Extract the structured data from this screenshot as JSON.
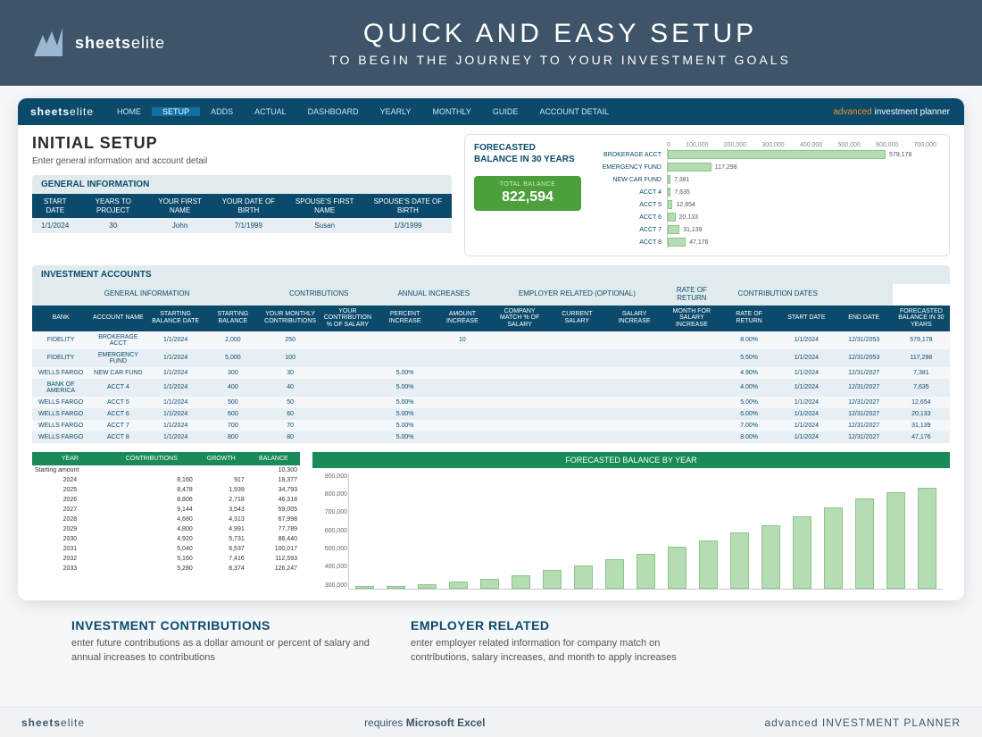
{
  "brand": {
    "name_bold": "sheets",
    "name_light": "elite"
  },
  "banner": {
    "title": "QUICK AND EASY SETUP",
    "subtitle": "TO BEGIN THE JOURNEY TO YOUR INVESTMENT GOALS"
  },
  "nav": {
    "items": [
      "HOME",
      "SETUP",
      "ADDS",
      "ACTUAL",
      "DASHBOARD",
      "YEARLY",
      "MONTHLY",
      "GUIDE",
      "ACCOUNT DETAIL"
    ],
    "active_index": 1,
    "right_adv": "advanced",
    "right_rest": " investment planner"
  },
  "page": {
    "title": "INITIAL SETUP",
    "subtitle": "Enter general information and account detail"
  },
  "general_info": {
    "title": "GENERAL INFORMATION",
    "headers": [
      "START DATE",
      "YEARS TO PROJECT",
      "YOUR FIRST NAME",
      "YOUR DATE OF BIRTH",
      "SPOUSE'S FIRST NAME",
      "SPOUSE'S DATE OF BIRTH"
    ],
    "row": [
      "1/1/2024",
      "30",
      "John",
      "7/1/1999",
      "Susan",
      "1/3/1999"
    ]
  },
  "forecast": {
    "title": "FORECASTED BALANCE IN 30 YEARS",
    "total_label": "TOTAL BALANCE",
    "total_value": "822,594",
    "axis": [
      "0",
      "100,000",
      "200,000",
      "300,000",
      "400,000",
      "500,000",
      "600,000",
      "700,000"
    ],
    "bars": [
      {
        "label": "BROKERAGE ACCT",
        "value": "579,178",
        "pct": 80
      },
      {
        "label": "EMERGENCY FUND",
        "value": "117,298",
        "pct": 16
      },
      {
        "label": "NEW CAR FUND",
        "value": "7,381",
        "pct": 1.0
      },
      {
        "label": "ACCT 4",
        "value": "7,635",
        "pct": 1.1
      },
      {
        "label": "ACCT 5",
        "value": "12,654",
        "pct": 1.8
      },
      {
        "label": "ACCT 6",
        "value": "20,133",
        "pct": 2.8
      },
      {
        "label": "ACCT 7",
        "value": "31,139",
        "pct": 4.3
      },
      {
        "label": "ACCT 8",
        "value": "47,176",
        "pct": 6.6
      }
    ]
  },
  "inv_accounts": {
    "title": "INVESTMENT ACCOUNTS",
    "groups": [
      "GENERAL INFORMATION",
      "CONTRIBUTIONS",
      "ANNUAL INCREASES",
      "EMPLOYER RELATED (OPTIONAL)",
      "RATE OF RETURN",
      "CONTRIBUTION DATES",
      ""
    ],
    "group_spans": [
      4,
      2,
      2,
      3,
      1,
      2,
      1
    ],
    "headers": [
      "BANK",
      "ACCOUNT NAME",
      "STARTING BALANCE DATE",
      "STARTING BALANCE",
      "YOUR MONTHLY CONTRIBUTIONS",
      "YOUR CONTRIBUTION % OF SALARY",
      "PERCENT INCREASE",
      "AMOUNT INCREASE",
      "COMPANY MATCH % OF SALARY",
      "CURRENT SALARY",
      "SALARY INCREASE",
      "MONTH FOR SALARY INCREASE",
      "RATE OF RETURN",
      "START DATE",
      "END DATE",
      "FORECASTED BALANCE IN 30 YEARS"
    ],
    "rows": [
      [
        "FIDELITY",
        "BROKERAGE ACCT",
        "1/1/2024",
        "2,000",
        "250",
        "",
        "",
        "10",
        "",
        "",
        "",
        "",
        "8.00%",
        "1/1/2024",
        "12/31/2053",
        "579,178"
      ],
      [
        "FIDELITY",
        "EMERGENCY FUND",
        "1/1/2024",
        "5,000",
        "100",
        "",
        "",
        "",
        "",
        "",
        "",
        "",
        "5.50%",
        "1/1/2024",
        "12/31/2053",
        "117,298"
      ],
      [
        "WELLS FARGO",
        "NEW CAR FUND",
        "1/1/2024",
        "300",
        "30",
        "",
        "5.00%",
        "",
        "",
        "",
        "",
        "",
        "4.90%",
        "1/1/2024",
        "12/31/2027",
        "7,381"
      ],
      [
        "BANK OF AMERICA",
        "ACCT 4",
        "1/1/2024",
        "400",
        "40",
        "",
        "5.00%",
        "",
        "",
        "",
        "",
        "",
        "4.00%",
        "1/1/2024",
        "12/31/2027",
        "7,635"
      ],
      [
        "WELLS FARGO",
        "ACCT 5",
        "1/1/2024",
        "500",
        "50",
        "",
        "5.00%",
        "",
        "",
        "",
        "",
        "",
        "5.00%",
        "1/1/2024",
        "12/31/2027",
        "12,654"
      ],
      [
        "WELLS FARGO",
        "ACCT 6",
        "1/1/2024",
        "600",
        "60",
        "",
        "5.00%",
        "",
        "",
        "",
        "",
        "",
        "6.00%",
        "1/1/2024",
        "12/31/2027",
        "20,133"
      ],
      [
        "WELLS FARGO",
        "ACCT 7",
        "1/1/2024",
        "700",
        "70",
        "",
        "5.00%",
        "",
        "",
        "",
        "",
        "",
        "7.00%",
        "1/1/2024",
        "12/31/2027",
        "31,139"
      ],
      [
        "WELLS FARGO",
        "ACCT 8",
        "1/1/2024",
        "800",
        "80",
        "",
        "5.00%",
        "",
        "",
        "",
        "",
        "",
        "8.00%",
        "1/1/2024",
        "12/31/2027",
        "47,176"
      ]
    ]
  },
  "yearly": {
    "headers": [
      "YEAR",
      "CONTRIBUTIONS",
      "GROWTH",
      "BALANCE"
    ],
    "starting_label": "Starting amount",
    "starting_balance": "10,300",
    "rows": [
      [
        "2024",
        "8,160",
        "917",
        "19,377"
      ],
      [
        "2025",
        "8,478",
        "1,939",
        "34,793"
      ],
      [
        "2026",
        "8,806",
        "2,718",
        "46,318"
      ],
      [
        "2027",
        "9,144",
        "3,543",
        "59,005"
      ],
      [
        "2028",
        "4,680",
        "4,313",
        "67,998"
      ],
      [
        "2029",
        "4,800",
        "4,991",
        "77,789"
      ],
      [
        "2030",
        "4,920",
        "5,731",
        "88,440"
      ],
      [
        "2031",
        "5,040",
        "6,537",
        "100,017"
      ],
      [
        "2032",
        "5,160",
        "7,416",
        "112,593"
      ],
      [
        "2033",
        "5,280",
        "8,374",
        "126,247"
      ]
    ]
  },
  "line_chart": {
    "title": "FORECASTED BALANCE BY YEAR",
    "ylabels": [
      "900,000",
      "800,000",
      "700,000",
      "600,000",
      "500,000",
      "400,000",
      "300,000"
    ]
  },
  "chart_data": [
    {
      "type": "bar",
      "title": "FORECASTED BALANCE IN 30 YEARS",
      "orientation": "horizontal",
      "xlim": [
        0,
        700000
      ],
      "categories": [
        "BROKERAGE ACCT",
        "EMERGENCY FUND",
        "NEW CAR FUND",
        "ACCT 4",
        "ACCT 5",
        "ACCT 6",
        "ACCT 7",
        "ACCT 8"
      ],
      "values": [
        579178,
        117298,
        7381,
        7635,
        12654,
        20133,
        31139,
        47176
      ]
    },
    {
      "type": "bar",
      "title": "FORECASTED BALANCE BY YEAR",
      "ylim": [
        300000,
        900000
      ],
      "x_range": "years (approx. 2035–2053, not labeled)",
      "values_approx": [
        300000,
        310000,
        320000,
        335000,
        350000,
        370000,
        395000,
        420000,
        450000,
        480000,
        515000,
        550000,
        590000,
        630000,
        675000,
        720000,
        770000,
        800000,
        823000
      ]
    }
  ],
  "callouts": [
    {
      "title": "INVESTMENT CONTRIBUTIONS",
      "body": "enter future contributions as a dollar amount or percent of salary and annual increases to contributions"
    },
    {
      "title": "EMPLOYER RELATED",
      "body": "enter employer related information for company match on contributions, salary increases, and month to apply increases"
    }
  ],
  "footer": {
    "center_pre": "requires ",
    "center_bold": "Microsoft Excel",
    "right_light": "advanced ",
    "right_rest": "INVESTMENT PLANNER"
  }
}
